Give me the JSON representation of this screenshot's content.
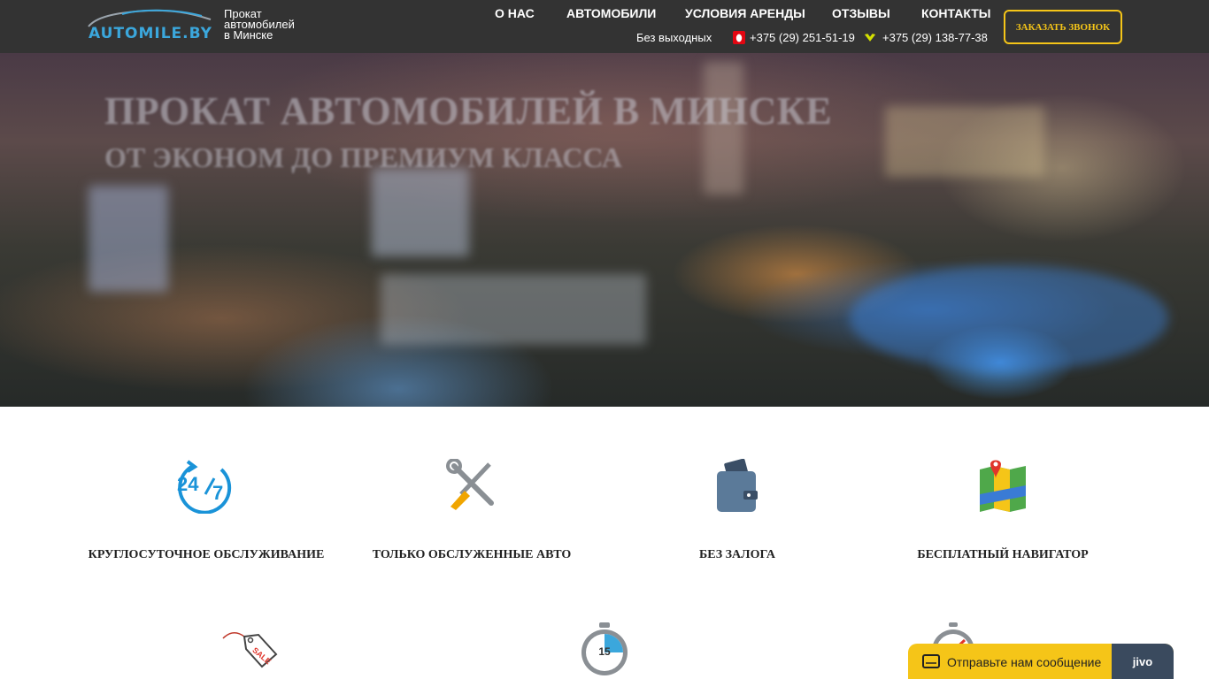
{
  "brand": {
    "logo_text": "AUTOMILE.BY",
    "tagline_lines": [
      "Прокат",
      "автомобилей",
      "в Минске"
    ]
  },
  "nav": {
    "items": [
      {
        "label": "О НАС"
      },
      {
        "label": "АВТОМОБИЛИ"
      },
      {
        "label": "УСЛОВИЯ АРЕНДЫ"
      },
      {
        "label": "ОТЗЫВЫ"
      },
      {
        "label": "КОНТАКТЫ"
      }
    ]
  },
  "contacts": {
    "schedule": "Без выходных",
    "phone_mts": "+375 (29) 251-51-19",
    "phone_velcom": "+375 (29) 138-77-38"
  },
  "header": {
    "call_button": "ЗАКАЗАТЬ ЗВОНОК"
  },
  "hero": {
    "title": "ПРОКАТ АВТОМОБИЛЕЙ В МИНСКЕ",
    "subtitle": "ОТ ЭКОНОМ ДО ПРЕМИУМ КЛАССА"
  },
  "features": [
    {
      "label": "КРУГЛОСУТОЧНОЕ ОБСЛУЖИВАНИЕ",
      "icon": "24-7-icon"
    },
    {
      "label": "ТОЛЬКО ОБСЛУЖЕННЫЕ АВТО",
      "icon": "tools-icon"
    },
    {
      "label": "БЕЗ ЗАЛОГА",
      "icon": "wallet-icon"
    },
    {
      "label": "БЕСПЛАТНЫЙ НАВИГАТОР",
      "icon": "map-icon"
    }
  ],
  "features_row2": [
    {
      "icon": "sale-tag-icon",
      "tag_text": "SALE"
    },
    {
      "icon": "stopwatch-icon",
      "value": "15"
    },
    {
      "icon": "speedometer-icon"
    }
  ],
  "chat": {
    "text": "Отправьте нам сообщение",
    "brand": "jivo"
  },
  "colors": {
    "accent_yellow": "#f5c518",
    "header_bg": "#333333",
    "logo_blue": "#3ba7dc"
  }
}
